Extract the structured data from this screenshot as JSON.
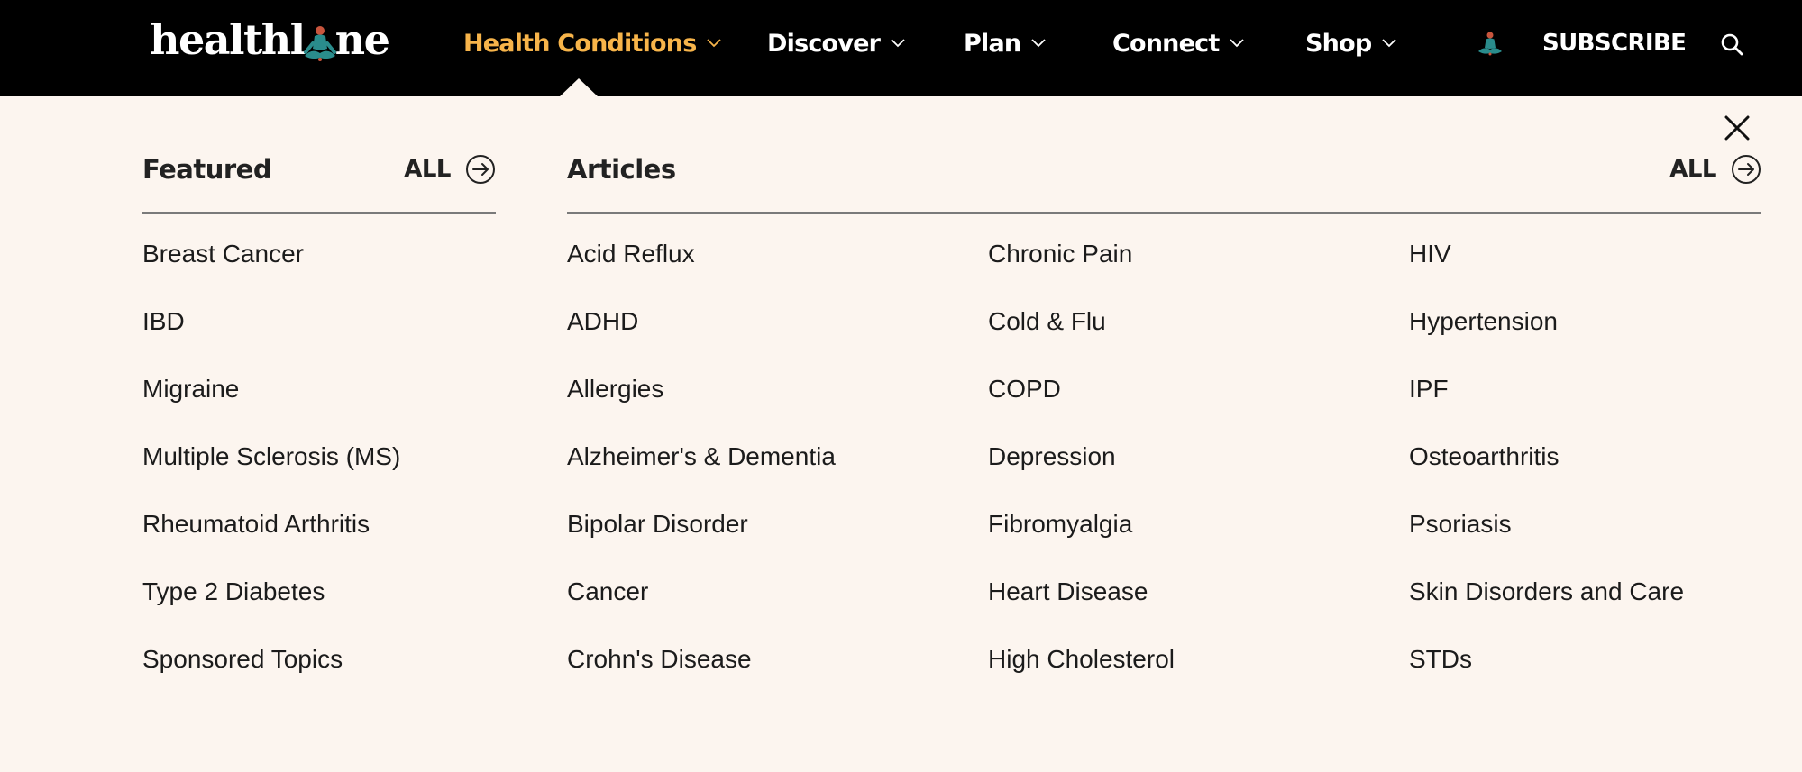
{
  "brand": {
    "logo_text_left": "healthl",
    "logo_text_right": "ne",
    "logo_figure": "meditating-person-icon",
    "accent_color": "#f7b44a"
  },
  "nav": {
    "items": [
      {
        "label": "Health Conditions",
        "active": true
      },
      {
        "label": "Discover",
        "active": false
      },
      {
        "label": "Plan",
        "active": false
      },
      {
        "label": "Connect",
        "active": false
      },
      {
        "label": "Shop",
        "active": false
      }
    ],
    "subscribe_label": "SUBSCRIBE",
    "search_icon": "search-icon",
    "profile_icon": "meditating-person-icon"
  },
  "menu": {
    "close_icon": "close-icon",
    "featured": {
      "title": "Featured",
      "all_label": "ALL",
      "items": [
        "Breast Cancer",
        "IBD",
        "Migraine",
        "Multiple Sclerosis (MS)",
        "Rheumatoid Arthritis",
        "Type 2 Diabetes",
        "Sponsored Topics"
      ]
    },
    "articles": {
      "title": "Articles",
      "all_label": "ALL",
      "columns": [
        [
          "Acid Reflux",
          "ADHD",
          "Allergies",
          "Alzheimer's & Dementia",
          "Bipolar Disorder",
          "Cancer",
          "Crohn's Disease"
        ],
        [
          "Chronic Pain",
          "Cold & Flu",
          "COPD",
          "Depression",
          "Fibromyalgia",
          "Heart Disease",
          "High Cholesterol"
        ],
        [
          "HIV",
          "Hypertension",
          "IPF",
          "Osteoarthritis",
          "Psoriasis",
          "Skin Disorders and Care",
          "STDs"
        ]
      ]
    }
  }
}
